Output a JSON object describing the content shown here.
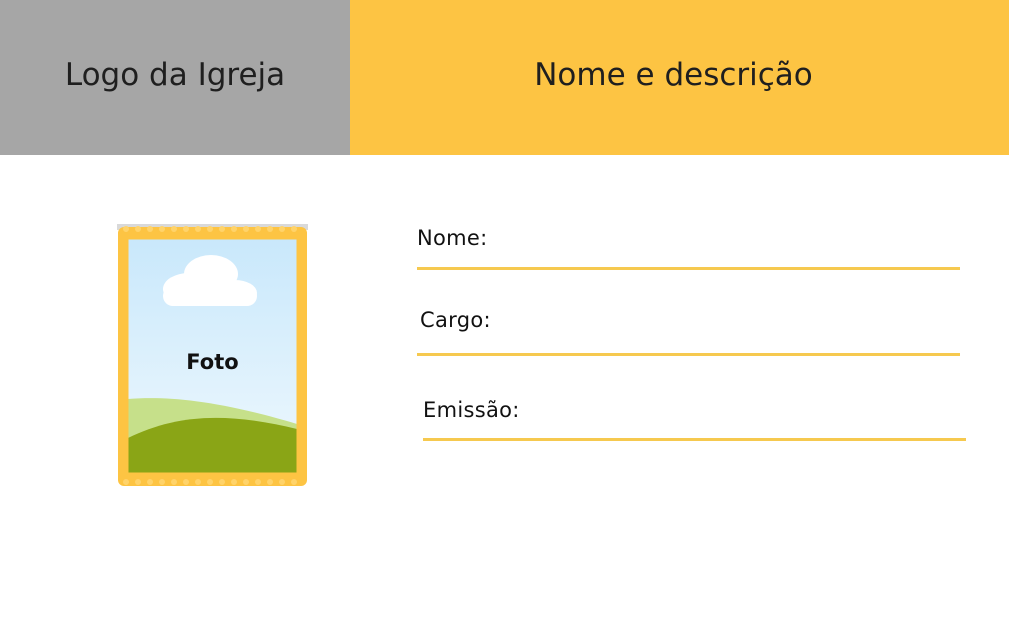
{
  "header": {
    "logo_text": "Logo da Igreja",
    "title_text": "Nome e descrição"
  },
  "photo": {
    "label": "Foto"
  },
  "fields": {
    "name_label": "Nome:",
    "role_label": "Cargo:",
    "issue_label": "Emissão:"
  },
  "colors": {
    "header_left_bg": "#a6a6a6",
    "header_right_bg": "#fdc443",
    "frame_yellow": "#fdc443",
    "field_line": "#f6c94f",
    "sky": "#d6eefc",
    "grass_light": "#c6e08a",
    "grass_dark": "#8aa516"
  }
}
